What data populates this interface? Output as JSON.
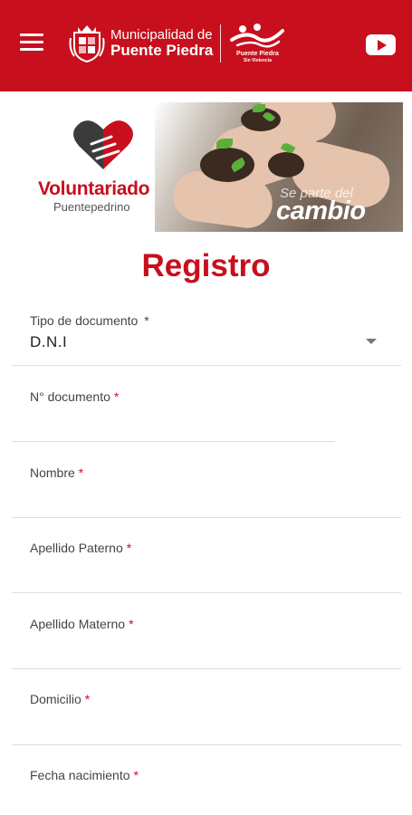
{
  "header": {
    "menu_icon": "hamburger-menu-icon",
    "brand_line1": "Municipalidad de",
    "brand_line2": "Puente Piedra",
    "partner_caption": "Puente Piedra",
    "partner_caption2": "Sin Violencia",
    "video_icon": "youtube-icon",
    "background_color": "#c70f1d"
  },
  "banner": {
    "title": "Voluntariado",
    "subtitle": "Puentepedrino",
    "slogan_small": "Se parte del",
    "slogan_big": "cambio"
  },
  "page": {
    "title": "Registro"
  },
  "form": {
    "doc_type": {
      "label": "Tipo de documento",
      "required_mark": "*",
      "value": "D.N.I"
    },
    "doc_number": {
      "label": "N° documento",
      "required_mark": "*"
    },
    "name": {
      "label": "Nombre",
      "required_mark": "*"
    },
    "last_name_paternal": {
      "label": "Apellido Paterno",
      "required_mark": "*"
    },
    "last_name_maternal": {
      "label": "Apellido Materno",
      "required_mark": "*"
    },
    "address": {
      "label": "Domicilio",
      "required_mark": "*"
    },
    "birth_date": {
      "label": "Fecha nacimiento",
      "required_mark": "*"
    }
  },
  "colors": {
    "accent": "#c70f1d",
    "divider": "#dddddd"
  }
}
